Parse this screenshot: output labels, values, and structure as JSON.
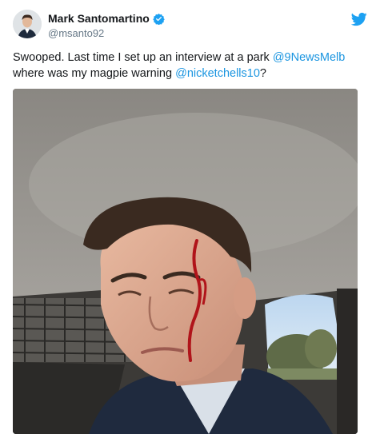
{
  "author": {
    "display_name": "Mark Santomartino",
    "handle": "@msanto92",
    "verified_icon": "verified-badge-icon",
    "avatar_icon": "avatar-portrait"
  },
  "platform_icon": "twitter-bird-icon",
  "tweet": {
    "text_parts": [
      "Swooped. Last time I set up an interview at a park ",
      "@9NewsMelb",
      " where was my magpie warning ",
      "@nicketchells10",
      "?"
    ]
  },
  "media": {
    "type": "photo",
    "description_icon": "selfie-photo"
  },
  "colors": {
    "text": "#14171a",
    "secondary": "#657786",
    "link": "#1b95e0",
    "twitter_blue": "#1da1f2"
  }
}
